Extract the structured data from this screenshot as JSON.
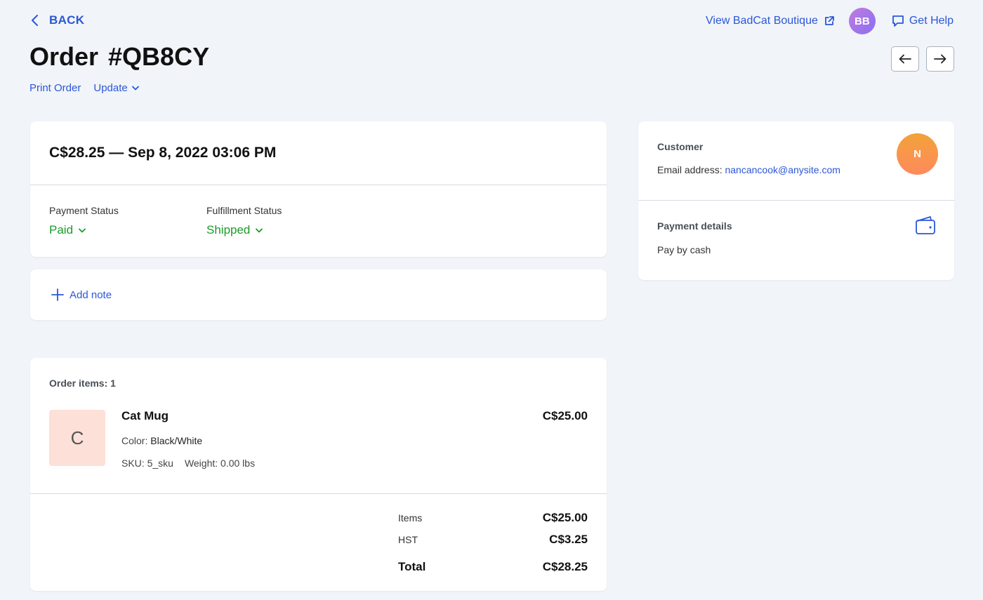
{
  "header": {
    "back_label": "BACK",
    "view_store_label": "View BadCat Boutique",
    "user_initials": "BB",
    "help_label": "Get Help",
    "order_title": "Order #QB8CY",
    "print_label": "Print Order",
    "update_label": "Update"
  },
  "summary": {
    "headline": "C$28.25 — Sep 8, 2022 03:06 PM",
    "payment_status_label": "Payment Status",
    "payment_status_value": "Paid",
    "fulfillment_status_label": "Fulfillment Status",
    "fulfillment_status_value": "Shipped"
  },
  "note": {
    "add_label": "Add note"
  },
  "items": {
    "count_label": "Order items: 1",
    "list": [
      {
        "thumb_letter": "C",
        "name": "Cat Mug",
        "price": "C$25.00",
        "color_label": "Color:",
        "color_value": "Black/White",
        "sku": "SKU: 5_sku",
        "weight": "Weight: 0.00 lbs"
      }
    ],
    "totals": {
      "items_label": "Items",
      "items_value": "C$25.00",
      "tax_label": "HST",
      "tax_value": "C$3.25",
      "total_label": "Total",
      "total_value": "C$28.25"
    }
  },
  "customer": {
    "title": "Customer",
    "email_label": "Email address:",
    "email": "nancancook@anysite.com",
    "initial": "N",
    "payment_title": "Payment details",
    "payment_method": "Pay by cash"
  },
  "colors": {
    "accent": "#2a57d8",
    "status_green": "#1c9a2a",
    "background": "#f1f4f8"
  },
  "icons": {
    "back": "chevron-left-icon",
    "external": "external-link-icon",
    "help": "chat-bubble-icon",
    "prev": "arrow-left-icon",
    "next": "arrow-right-icon",
    "dropdown": "chevron-down-icon",
    "add": "plus-icon",
    "wallet": "wallet-icon"
  }
}
